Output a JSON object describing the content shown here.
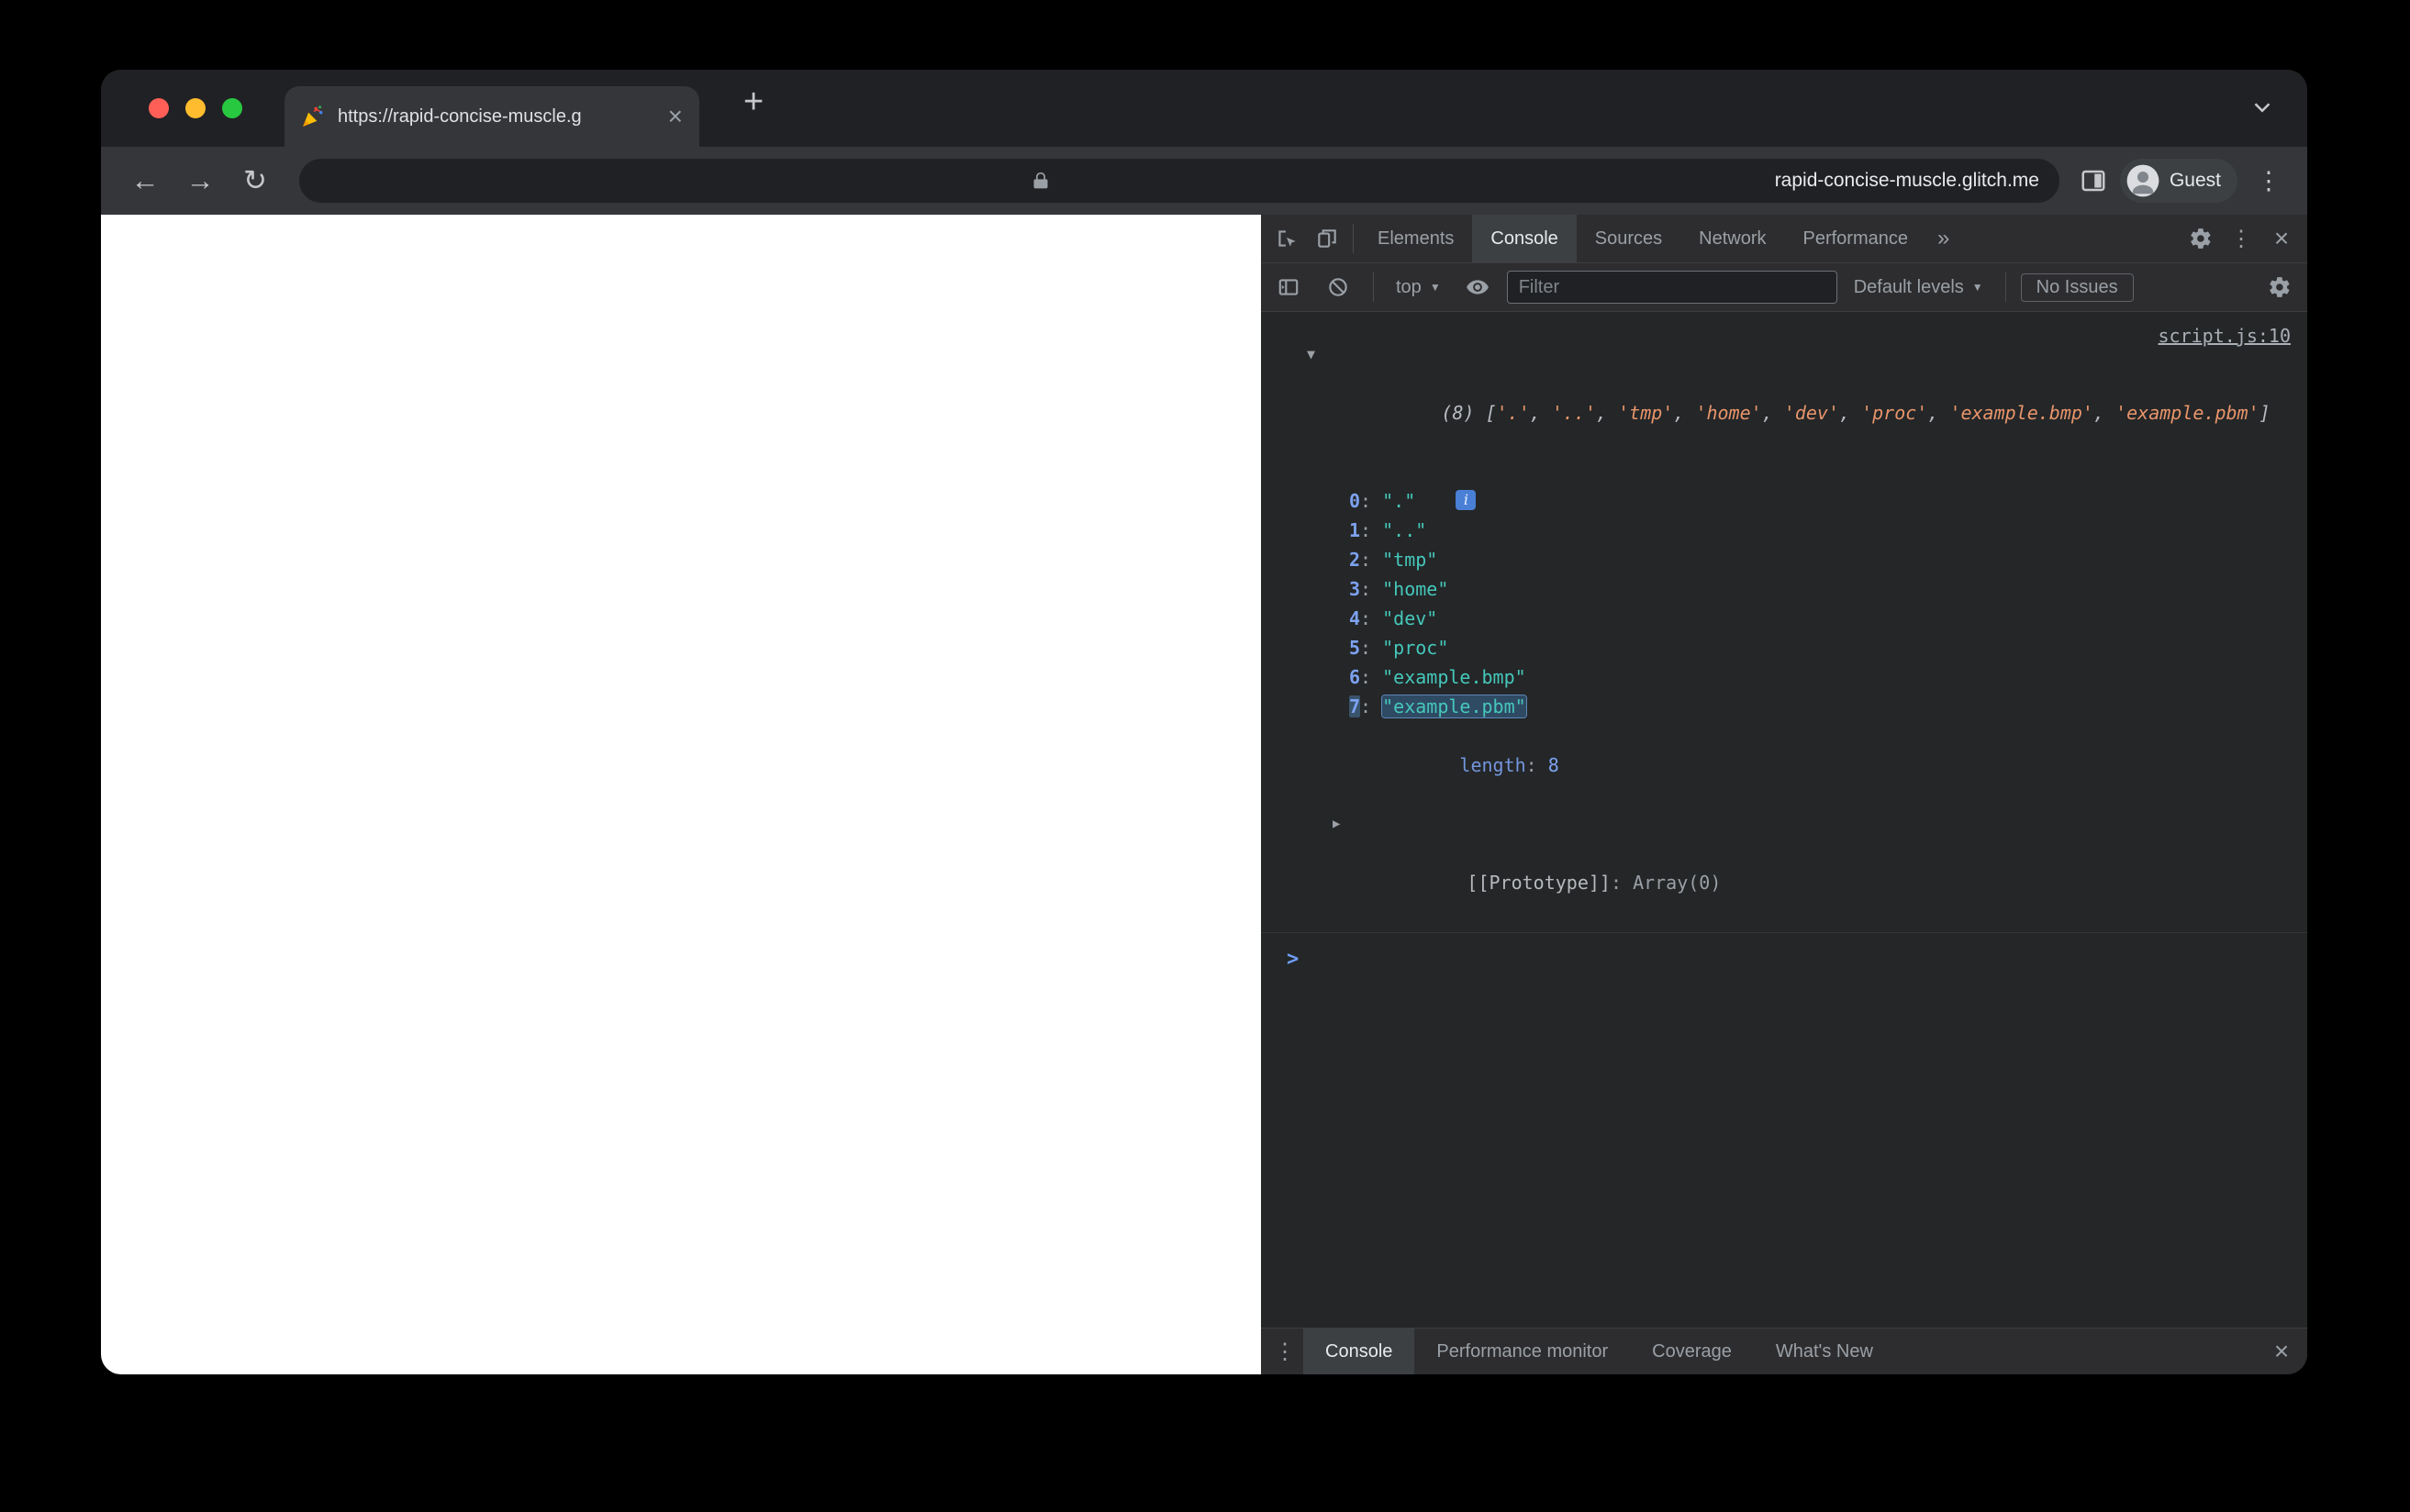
{
  "browser": {
    "tab": {
      "title": "https://rapid-concise-muscle.g",
      "close": "×",
      "favicon_icon": "party-popper-icon"
    },
    "new_tab": "+",
    "nav": {
      "back": "←",
      "forward": "→",
      "reload": "↻"
    },
    "url": "rapid-concise-muscle.glitch.me",
    "profile": "Guest",
    "menu": "⋮"
  },
  "devtools": {
    "tabs": [
      "Elements",
      "Console",
      "Sources",
      "Network",
      "Performance"
    ],
    "active_tab": "Console",
    "more_tabs": "»",
    "menu": "⋮",
    "close": "×",
    "toolbar": {
      "context": "top",
      "dropdown_arrow": "▼",
      "filter_placeholder": "Filter",
      "levels_label": "Default levels",
      "issues_label": "No Issues"
    },
    "console": {
      "source_link": "script.js:10",
      "collapse_triangle": "▼",
      "expand_triangle": "▶",
      "info_icon": "i",
      "preview_count": "(8)",
      "preview_items": [
        "'.'",
        "'..'",
        "'tmp'",
        "'home'",
        "'dev'",
        "'proc'",
        "'example.bmp'",
        "'example.pbm'"
      ],
      "entries": [
        {
          "key": "0",
          "value": "\".\""
        },
        {
          "key": "1",
          "value": "\"..\""
        },
        {
          "key": "2",
          "value": "\"tmp\""
        },
        {
          "key": "3",
          "value": "\"home\""
        },
        {
          "key": "4",
          "value": "\"dev\""
        },
        {
          "key": "5",
          "value": "\"proc\""
        },
        {
          "key": "6",
          "value": "\"example.bmp\""
        },
        {
          "key": "7",
          "value": "\"example.pbm\"",
          "highlighted": true
        }
      ],
      "colon": ": ",
      "length_label": "length",
      "length_value": "8",
      "prototype_label": "[[Prototype]]",
      "prototype_value": "Array(0)",
      "prompt": ">"
    },
    "drawer": {
      "menu_icon": "⋮",
      "tabs": [
        "Console",
        "Performance monitor",
        "Coverage",
        "What's New"
      ],
      "active": "Console",
      "close": "×"
    }
  }
}
